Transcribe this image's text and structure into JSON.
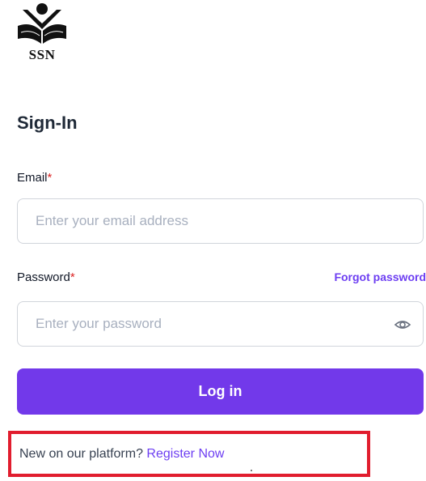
{
  "logo": {
    "text": "SSN"
  },
  "form": {
    "title": "Sign-In",
    "email": {
      "label": "Email",
      "required_mark": "*",
      "placeholder": "Enter your email address"
    },
    "password": {
      "label": "Password",
      "required_mark": "*",
      "placeholder": "Enter your password",
      "forgot_label": "Forgot password",
      "toggle_icon": "eye-icon"
    },
    "login_button": "Log in",
    "register": {
      "prompt": "New on our platform?",
      "link": "Register Now"
    }
  },
  "colors": {
    "accent": "#7239ea",
    "link": "#6d3ef2",
    "required": "#dc2626",
    "highlight_box": "#e11d2e"
  }
}
